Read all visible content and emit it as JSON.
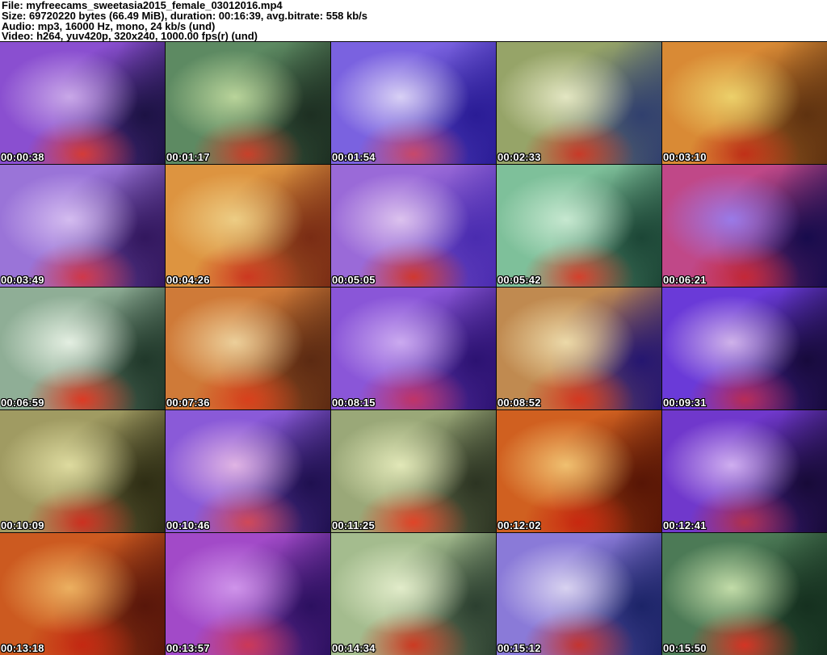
{
  "header": {
    "file_line": "File: myfreecams_sweetasia2015_female_03012016.mp4",
    "size_line": "Size: 69720220 bytes (66.49 MiB), duration: 00:16:39, avg.bitrate: 558 kb/s",
    "audio_line": "Audio: mp3, 16000 Hz, mono, 24 kb/s (und)",
    "video_line": "Video: h264, yuv420p, 320x240, 1000.00 fps(r) (und)"
  },
  "grid": {
    "columns": 5,
    "rows": 5
  },
  "colors": {
    "header_bg": "#ffffff",
    "header_text": "#000000",
    "timestamp_text": "#ffffff",
    "timestamp_outline": "#000000",
    "grid_line": "#0a0a0a"
  },
  "thumbnails": [
    {
      "timestamp": "00:00:38",
      "colors": [
        "#c9a8e8",
        "#8a4fd0",
        "#1c1244",
        "#d43b38"
      ]
    },
    {
      "timestamp": "00:01:17",
      "colors": [
        "#b9d49a",
        "#5d8a62",
        "#1d2f22",
        "#c8402a"
      ]
    },
    {
      "timestamp": "00:01:54",
      "colors": [
        "#d8d0f5",
        "#7a62e0",
        "#2a1c96",
        "#c8486a"
      ]
    },
    {
      "timestamp": "00:02:33",
      "colors": [
        "#e3e6c2",
        "#96a468",
        "#31406e",
        "#c83a28"
      ]
    },
    {
      "timestamp": "00:03:10",
      "colors": [
        "#ecd06a",
        "#d98a35",
        "#5f3210",
        "#c03018"
      ]
    },
    {
      "timestamp": "00:03:49",
      "colors": [
        "#d4bcf0",
        "#9a74d8",
        "#32175e",
        "#d0384a"
      ]
    },
    {
      "timestamp": "00:04:26",
      "colors": [
        "#edcd84",
        "#dd9440",
        "#7a2c14",
        "#cc3820"
      ]
    },
    {
      "timestamp": "00:05:05",
      "colors": [
        "#dcc2ee",
        "#9a6ad8",
        "#4a2cb0",
        "#d03830"
      ]
    },
    {
      "timestamp": "00:05:42",
      "colors": [
        "#c6e8d0",
        "#7ec09a",
        "#1c4636",
        "#d4402c"
      ]
    },
    {
      "timestamp": "00:06:21",
      "colors": [
        "#9a7ae8",
        "#c04888",
        "#170b4c",
        "#c42838"
      ]
    },
    {
      "timestamp": "00:06:59",
      "colors": [
        "#e4efe2",
        "#8fae96",
        "#20382a",
        "#dc3a24"
      ]
    },
    {
      "timestamp": "00:07:36",
      "colors": [
        "#eccf9a",
        "#cf7a38",
        "#5c2a12",
        "#d8401c"
      ]
    },
    {
      "timestamp": "00:08:15",
      "colors": [
        "#cbaaf0",
        "#8a56d8",
        "#2c1272",
        "#c03468"
      ]
    },
    {
      "timestamp": "00:08:52",
      "colors": [
        "#ecd9a8",
        "#c08a50",
        "#251670",
        "#d43820"
      ]
    },
    {
      "timestamp": "00:09:31",
      "colors": [
        "#cfb2ea",
        "#6a3ad8",
        "#170a3c",
        "#b82c58"
      ]
    },
    {
      "timestamp": "00:10:09",
      "colors": [
        "#dedb9f",
        "#a09b62",
        "#2e2d14",
        "#cc3020"
      ]
    },
    {
      "timestamp": "00:10:46",
      "colors": [
        "#e0b4e4",
        "#8a5ad8",
        "#1f1050",
        "#d04858"
      ]
    },
    {
      "timestamp": "00:11:25",
      "colors": [
        "#e2e8b8",
        "#9aa878",
        "#2c3422",
        "#e04428"
      ]
    },
    {
      "timestamp": "00:12:02",
      "colors": [
        "#f0c070",
        "#d06020",
        "#571505",
        "#c82810"
      ]
    },
    {
      "timestamp": "00:12:41",
      "colors": [
        "#cfaef0",
        "#7038cc",
        "#170a38",
        "#b03050"
      ]
    },
    {
      "timestamp": "00:13:18",
      "colors": [
        "#ecb060",
        "#cc5a20",
        "#58160a",
        "#c42812"
      ]
    },
    {
      "timestamp": "00:13:57",
      "colors": [
        "#cf94ea",
        "#a24ac8",
        "#2c1060",
        "#cc3858"
      ]
    },
    {
      "timestamp": "00:14:34",
      "colors": [
        "#e2ecca",
        "#a4bc8e",
        "#2c4030",
        "#cc3a22"
      ]
    },
    {
      "timestamp": "00:15:12",
      "colors": [
        "#d8d2f0",
        "#8a7ad8",
        "#1c2468",
        "#c43430"
      ]
    },
    {
      "timestamp": "00:15:50",
      "colors": [
        "#c2dca8",
        "#4c7a56",
        "#15301f",
        "#d43424"
      ]
    }
  ]
}
